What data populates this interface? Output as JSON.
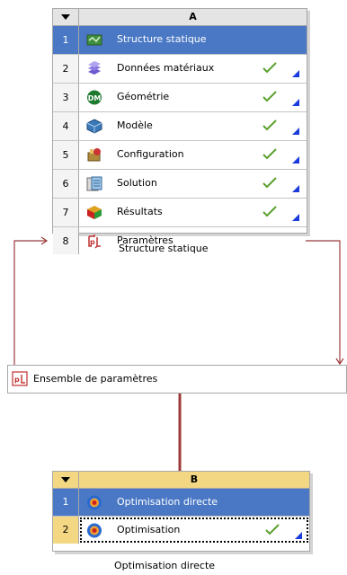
{
  "system_a": {
    "letter": "A",
    "caption": "Structure statique",
    "rows": [
      {
        "num": "1",
        "label": "Structure statique",
        "status": "",
        "selected": true
      },
      {
        "num": "2",
        "label": "Données matériaux",
        "status": "up-to-date"
      },
      {
        "num": "3",
        "label": "Géométrie",
        "status": "up-to-date"
      },
      {
        "num": "4",
        "label": "Modèle",
        "status": "up-to-date"
      },
      {
        "num": "5",
        "label": "Configuration",
        "status": "up-to-date"
      },
      {
        "num": "6",
        "label": "Solution",
        "status": "up-to-date"
      },
      {
        "num": "7",
        "label": "Résultats",
        "status": "up-to-date"
      },
      {
        "num": "8",
        "label": "Paramètres",
        "status": ""
      }
    ]
  },
  "parameter_set": {
    "label": "Ensemble de paramètres"
  },
  "system_b": {
    "letter": "B",
    "caption": "Optimisation directe",
    "rows": [
      {
        "num": "1",
        "label": "Optimisation directe",
        "status": "",
        "selected": true
      },
      {
        "num": "2",
        "label": "Optimisation",
        "status": "up-to-date"
      }
    ]
  },
  "colors": {
    "selected_row": "#4a78c4",
    "header_b": "#f3d783",
    "link": "#9c3a3a",
    "check": "#5aa02c",
    "corner": "#1a3cdc"
  },
  "icons": {
    "a1": "static-structural-icon",
    "a2": "engineering-data-icon",
    "a3": "geometry-icon",
    "a4": "model-icon",
    "a5": "setup-icon",
    "a6": "solution-icon",
    "a7": "results-icon",
    "a8": "parameters-icon",
    "params": "parameter-set-icon",
    "b1": "direct-optimization-icon",
    "b2": "optimization-icon"
  }
}
